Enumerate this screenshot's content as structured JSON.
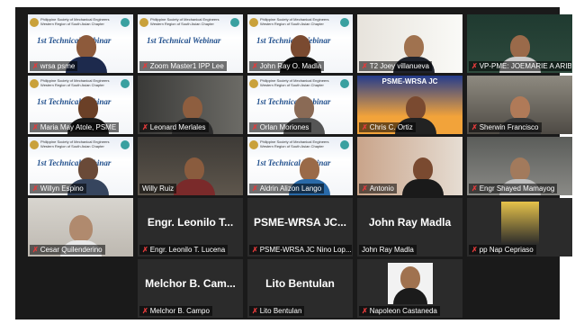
{
  "webinar": {
    "header_line1": "Philippine Society of Mechanical Engineers",
    "header_line2": "Western Region of South Asian Chapter",
    "title": "1st Technical Webinar"
  },
  "tiles": [
    {
      "name": "wrsa psme"
    },
    {
      "name": "Zoom Master1 IPP Lee"
    },
    {
      "name": "John Ray O. Madla"
    },
    {
      "name": "T2 Joey villanueva"
    },
    {
      "name": "VP-PME: JOEMARIE A ARIB"
    },
    {
      "name": "Maria May Atole, PSME"
    },
    {
      "name": "Leonard Merlales"
    },
    {
      "name": "Orlan Moriones"
    },
    {
      "name": "Chris C. Ortiz"
    },
    {
      "name": "Sherwin Francisco"
    },
    {
      "name": "Willyn Espino"
    },
    {
      "name": "Willy Ruiz"
    },
    {
      "name": "Aldrin Alizon Lango"
    },
    {
      "name": "Antonio"
    },
    {
      "name": "Engr Shayed Mamayog"
    },
    {
      "name": "Cesar Quilenderino"
    },
    {
      "name": "Engr. Leonilo T. Lucena",
      "big": "Engr. Leonilo T..."
    },
    {
      "name": "PSME-WRSA JC Nino Lop...",
      "big": "PSME-WRSA JC..."
    },
    {
      "name": "John Ray Madla",
      "big": "John Ray Madla"
    },
    {
      "name": "pp Nap Cepriaso"
    },
    {
      "name": "Melchor B. Campo",
      "big": "Melchor B. Cam..."
    },
    {
      "name": "Lito Bentulan",
      "big": "Lito Bentulan"
    },
    {
      "name": "Napoleon Castaneda"
    }
  ],
  "psme_banner": "PSME-WRSA JC",
  "colors": {
    "active_border": "#9ee35d",
    "mic_muted": "#e23b3b"
  }
}
